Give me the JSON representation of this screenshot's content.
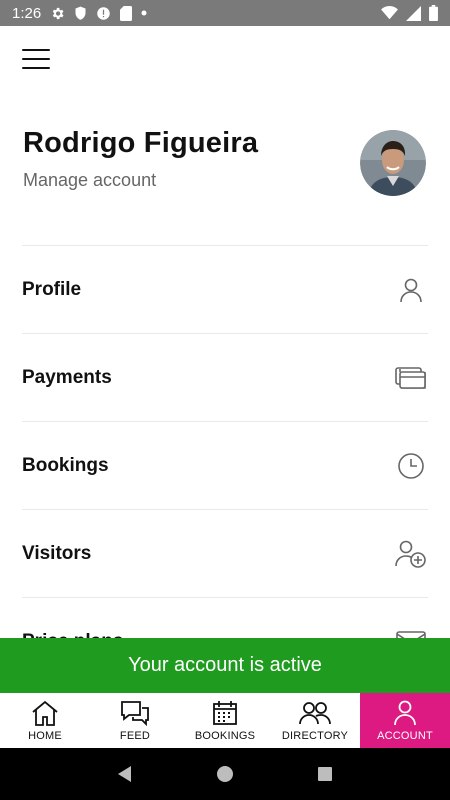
{
  "status_bar": {
    "time": "1:26",
    "icons": [
      "settings-icon",
      "shield-icon",
      "alert-icon",
      "sd-card-icon",
      "dot-icon",
      "wifi-icon",
      "signal-icon",
      "battery-icon"
    ]
  },
  "header": {
    "user_name": "Rodrigo Figueira",
    "manage_account": "Manage account"
  },
  "menu": {
    "items": [
      {
        "label": "Profile",
        "icon": "person-icon"
      },
      {
        "label": "Payments",
        "icon": "cards-icon"
      },
      {
        "label": "Bookings",
        "icon": "clock-icon"
      },
      {
        "label": "Visitors",
        "icon": "add-person-icon"
      },
      {
        "label": "Price plans",
        "icon": "envelope-icon"
      }
    ]
  },
  "banner": {
    "text": "Your account is active",
    "color": "#1f9c1f"
  },
  "bottom_nav": {
    "active": "ACCOUNT",
    "active_color": "#dc1a82",
    "items": [
      {
        "label": "HOME",
        "icon": "home-icon"
      },
      {
        "label": "FEED",
        "icon": "chat-icon"
      },
      {
        "label": "BOOKINGS",
        "icon": "calendar-icon"
      },
      {
        "label": "DIRECTORY",
        "icon": "people-icon"
      },
      {
        "label": "ACCOUNT",
        "icon": "person-icon"
      }
    ]
  }
}
